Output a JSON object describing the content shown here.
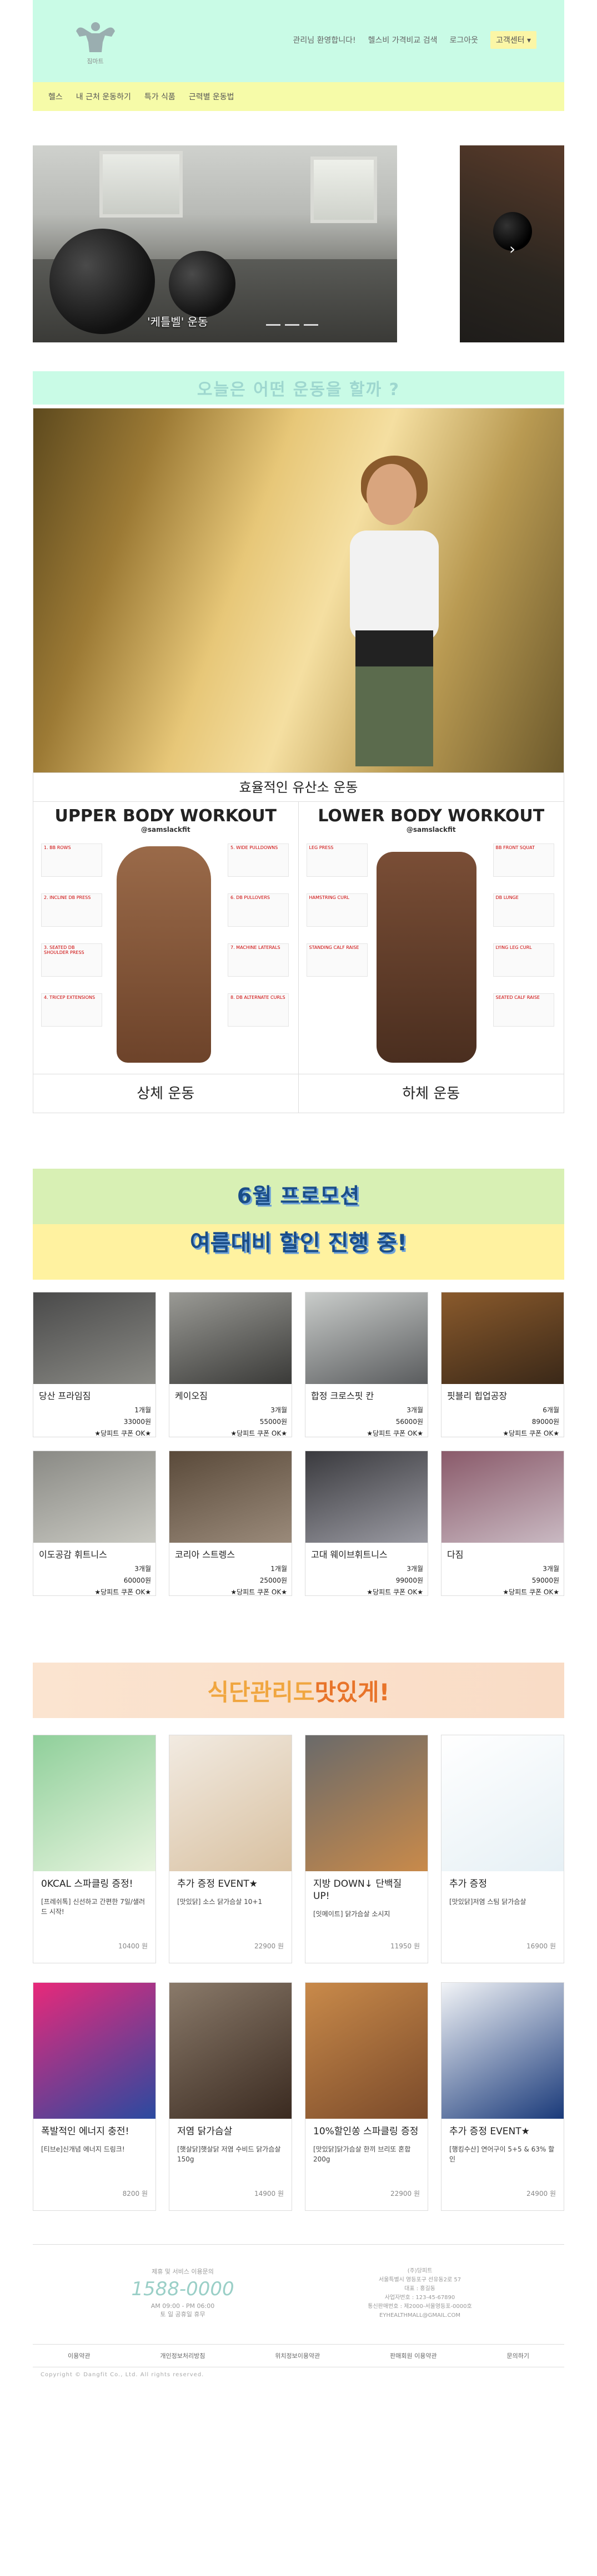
{
  "header": {
    "logo_label": "짐마트",
    "top_links": [
      "관리님 환영합니다!",
      "헬스비 가격비교 검색",
      "로그아웃"
    ],
    "cs_label": "고객센터 ▾"
  },
  "nav": [
    "헬스",
    "내 근처 운동하기",
    "특가 식품",
    "근력별 운동법"
  ],
  "hero": {
    "caption": "'케틀벨' 운동",
    "next_arrow": "›"
  },
  "exercise_section": {
    "title": "오늘은 어떤 운동을 할까 ?",
    "cardio_label": "효율적인 유산소 운동",
    "upper": {
      "poster_title": "UPPER BODY WORKOUT",
      "handle": "@samslackfit",
      "label": "상체 운동",
      "exercises_left": [
        "1. BB ROWS",
        "2. INCLINE DB PRESS",
        "3. SEATED DB SHOULDER PRESS",
        "4. TRICEP EXTENSIONS"
      ],
      "exercises_right": [
        "5. WIDE PULLDOWNS",
        "6. DB PULLOVERS",
        "7. MACHINE LATERALS",
        "8. DB ALTERNATE CURLS"
      ]
    },
    "lower": {
      "poster_title": "LOWER BODY WORKOUT",
      "handle": "@samslackfit",
      "label": "하체 운동",
      "exercises_left": [
        "LEG PRESS",
        "HAMSTRING CURL",
        "STANDING CALF RAISE"
      ],
      "exercises_right": [
        "BB FRONT SQUAT",
        "DB LUNGE",
        "LYING LEG CURL",
        "SEATED CALF RAISE"
      ]
    }
  },
  "promo": {
    "line1": "6월 프로모션",
    "line2": "여름대비 할인 진행 중!",
    "gyms": [
      {
        "name": "당산 프라임짐",
        "period": "1개월",
        "price": "33000원",
        "tag": "★당피트 쿠폰 OK★",
        "color1": "#4a4a4a",
        "color2": "#8a8a85"
      },
      {
        "name": "케이오짐",
        "period": "3개월",
        "price": "55000원",
        "tag": "★당피트 쿠폰 OK★",
        "color1": "#9a9a95",
        "color2": "#3a3a38"
      },
      {
        "name": "합정 크로스핏 칸",
        "period": "3개월",
        "price": "56000원",
        "tag": "★당피트 쿠폰 OK★",
        "color1": "#c9ccca",
        "color2": "#5a5c5e"
      },
      {
        "name": "핏블리 힙업공장",
        "period": "6개월",
        "price": "89000원",
        "tag": "★당피트 쿠폰 OK★",
        "color1": "#8a5a2c",
        "color2": "#3a2818"
      },
      {
        "name": "이도공감 휘트니스",
        "period": "3개월",
        "price": "60000원",
        "tag": "★당피트 쿠폰 OK★",
        "color1": "#8a8a85",
        "color2": "#c9c9c2"
      },
      {
        "name": "코리아 스트렝스",
        "period": "1개월",
        "price": "25000원",
        "tag": "★당피트 쿠폰 OK★",
        "color1": "#5a4a3a",
        "color2": "#9a8a7a"
      },
      {
        "name": "고대 웨이브휘트니스",
        "period": "3개월",
        "price": "99000원",
        "tag": "★당피트 쿠폰 OK★",
        "color1": "#3a3a3e",
        "color2": "#9a9aa2"
      },
      {
        "name": "다짐",
        "period": "3개월",
        "price": "59000원",
        "tag": "★당피트 쿠폰 OK★",
        "color1": "#8a5a6a",
        "color2": "#c9b9c2"
      }
    ]
  },
  "diet": {
    "title_a": "식단관리도 ",
    "title_b": "맛있게!",
    "foods": [
      {
        "name": "0KCAL 스파클링 증정!",
        "desc": "[프레쉬톡] 신선하고 간편한 7일/샐러드 시작!",
        "price": "10400 원",
        "color1": "#8fcf9a",
        "color2": "#e9f5e0"
      },
      {
        "name": "추가 증정 EVENT★",
        "desc": "[맛있닭] 소스 닭가슴살 10+1",
        "price": "22900 원",
        "color1": "#f2ebe2",
        "color2": "#d8c0a0"
      },
      {
        "name": "지방 DOWN↓ 단백질 UP!",
        "desc": "[잇메이트] 닭가슴살 소시지",
        "price": "11950 원",
        "color1": "#6a6a6a",
        "color2": "#c98a4a"
      },
      {
        "name": "추가 증정",
        "desc": "[맛있닭]저염 스팀 닭가슴살",
        "price": "16900 원",
        "color1": "#ffffff",
        "color2": "#e6f0f5"
      },
      {
        "name": "폭발적인 에너지 충전!",
        "desc": "[티브e]신개념 에너지 드링크!",
        "price": "8200 원",
        "color1": "#e8297a",
        "color2": "#2a4aa0"
      },
      {
        "name": "저염 닭가슴살",
        "desc": "[햇살닭]햇살닭 저염 수비드 닭가슴살 150g",
        "price": "14900 원",
        "color1": "#8a7a6a",
        "color2": "#3a2a20"
      },
      {
        "name": "10%할인쏭 스파클링 증정",
        "desc": "[맛있닭]닭가슴살 한끼 브리또 혼합 200g",
        "price": "22900 원",
        "color1": "#c98a4a",
        "color2": "#7a4a2a"
      },
      {
        "name": "추가 증정 EVENT★",
        "desc": "[행킹수산] 연어구이 5+5 & 63% 할인",
        "price": "24900 원",
        "color1": "#f2f4f7",
        "color2": "#1a3a7a"
      }
    ]
  },
  "footer": {
    "cs_title": "제휴 및 서비스 이용문의",
    "phone": "1588-0000",
    "hours": "AM 09:00 - PM 06:00",
    "holiday": "토 일 공휴일 휴무",
    "company_lines": [
      "(주)당피트",
      "서울특별시 영등포구 선유동2로 57",
      "대표 : 홍길동",
      "사업자번호 : 123-45-67890",
      "통신판매번호 : 제2000-서울영등포-0000호",
      "EYHEALTHMALL@GMAIL.COM"
    ],
    "links": [
      "이용약관",
      "개인정보처리방침",
      "위치정보이용약관",
      "판매회원 이용약관",
      "문의하기"
    ],
    "copyright": "Copyright © Dangfit Co., Ltd. All rights reserved."
  }
}
